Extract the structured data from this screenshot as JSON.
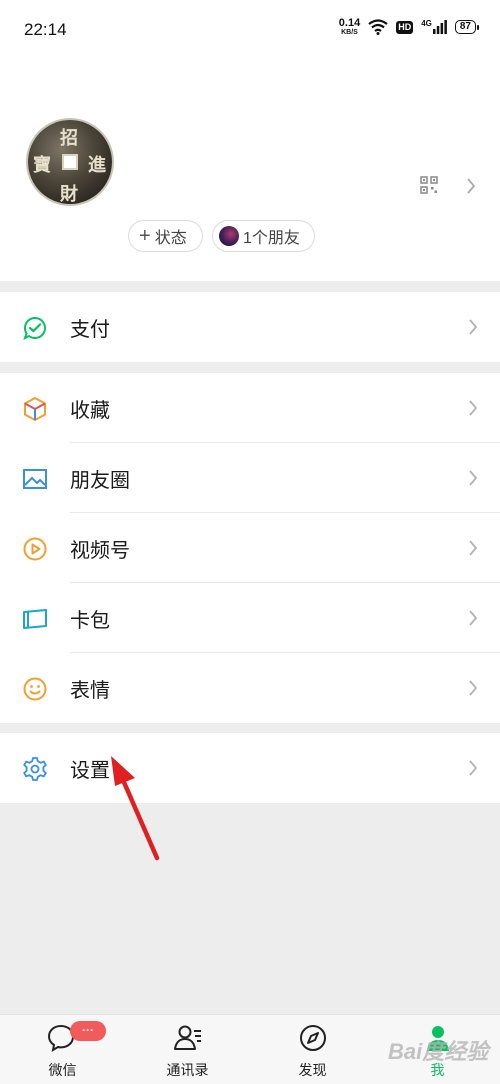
{
  "status_bar": {
    "time": "22:14",
    "net_speed": "0.14",
    "net_unit": "KB/S",
    "hd": "HD",
    "signal": "4G",
    "battery": "87"
  },
  "profile": {
    "avatar_chars": [
      "招",
      "財",
      "寶",
      "進"
    ],
    "status_button": "状态",
    "friends_button": "1个朋友"
  },
  "menu": {
    "pay": "支付",
    "favorites": "收藏",
    "moments": "朋友圈",
    "channels": "视频号",
    "cards": "卡包",
    "stickers": "表情",
    "settings": "设置"
  },
  "tabbar": {
    "chats": "微信",
    "contacts": "通讯录",
    "discover": "发现",
    "me": "我",
    "chats_badge": "···",
    "active_tab": "me"
  },
  "colors": {
    "accent_green": "#07c160",
    "badge_red": "#f25b5b",
    "annotation_red": "#e02020"
  },
  "watermark": "Bai度经验"
}
